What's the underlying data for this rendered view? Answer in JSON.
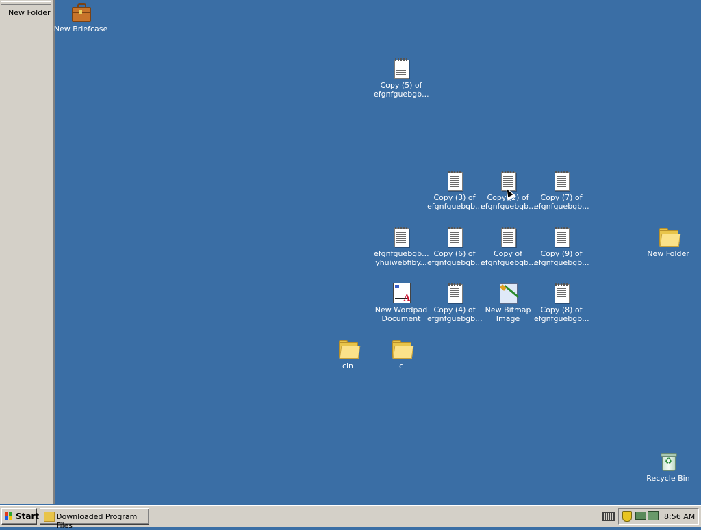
{
  "side_panel": {
    "title": "New Folder"
  },
  "desktop_icons": [
    {
      "id": "new-briefcase",
      "type": "briefcase",
      "label": "New Briefcase"
    },
    {
      "id": "copy5",
      "type": "text",
      "label": "Copy (5) of\nefgnfguebgb..."
    },
    {
      "id": "copy3",
      "type": "text",
      "label": "Copy (3) of\nefgnfguebgb..."
    },
    {
      "id": "copy2",
      "type": "text",
      "label": "Copy (2) of\nefgnfguebgb..."
    },
    {
      "id": "copy7",
      "type": "text",
      "label": "Copy (7) of\nefgnfguebgb..."
    },
    {
      "id": "efgn",
      "type": "text",
      "label": "efgnfguebgb...\nyhuiwebfiby..."
    },
    {
      "id": "copy6",
      "type": "text",
      "label": "Copy (6) of\nefgnfguebgb..."
    },
    {
      "id": "copyof",
      "type": "text",
      "label": "Copy of\nefgnfguebgb..."
    },
    {
      "id": "copy9",
      "type": "text",
      "label": "Copy (9) of\nefgnfguebgb..."
    },
    {
      "id": "new-folder",
      "type": "folder",
      "label": "New Folder"
    },
    {
      "id": "wordpad",
      "type": "wordpad",
      "label": "New Wordpad\nDocument"
    },
    {
      "id": "copy4",
      "type": "text",
      "label": "Copy (4) of\nefgnfguebgb..."
    },
    {
      "id": "bitmap",
      "type": "bitmap",
      "label": "New Bitmap\nImage"
    },
    {
      "id": "copy8",
      "type": "text",
      "label": "Copy (8) of\nefgnfguebgb..."
    },
    {
      "id": "cin",
      "type": "folder",
      "label": "cin"
    },
    {
      "id": "c",
      "type": "folder",
      "label": "c"
    },
    {
      "id": "recycle-bin",
      "type": "recycle-bin",
      "label": "Recycle Bin"
    }
  ],
  "taskbar": {
    "start_label": "Start",
    "task_buttons": [
      "Downloaded Program Files"
    ],
    "clock": "8:56 AM"
  },
  "colors": {
    "desktop": "#3a6ea5",
    "taskbar": "#d4d0c8"
  }
}
